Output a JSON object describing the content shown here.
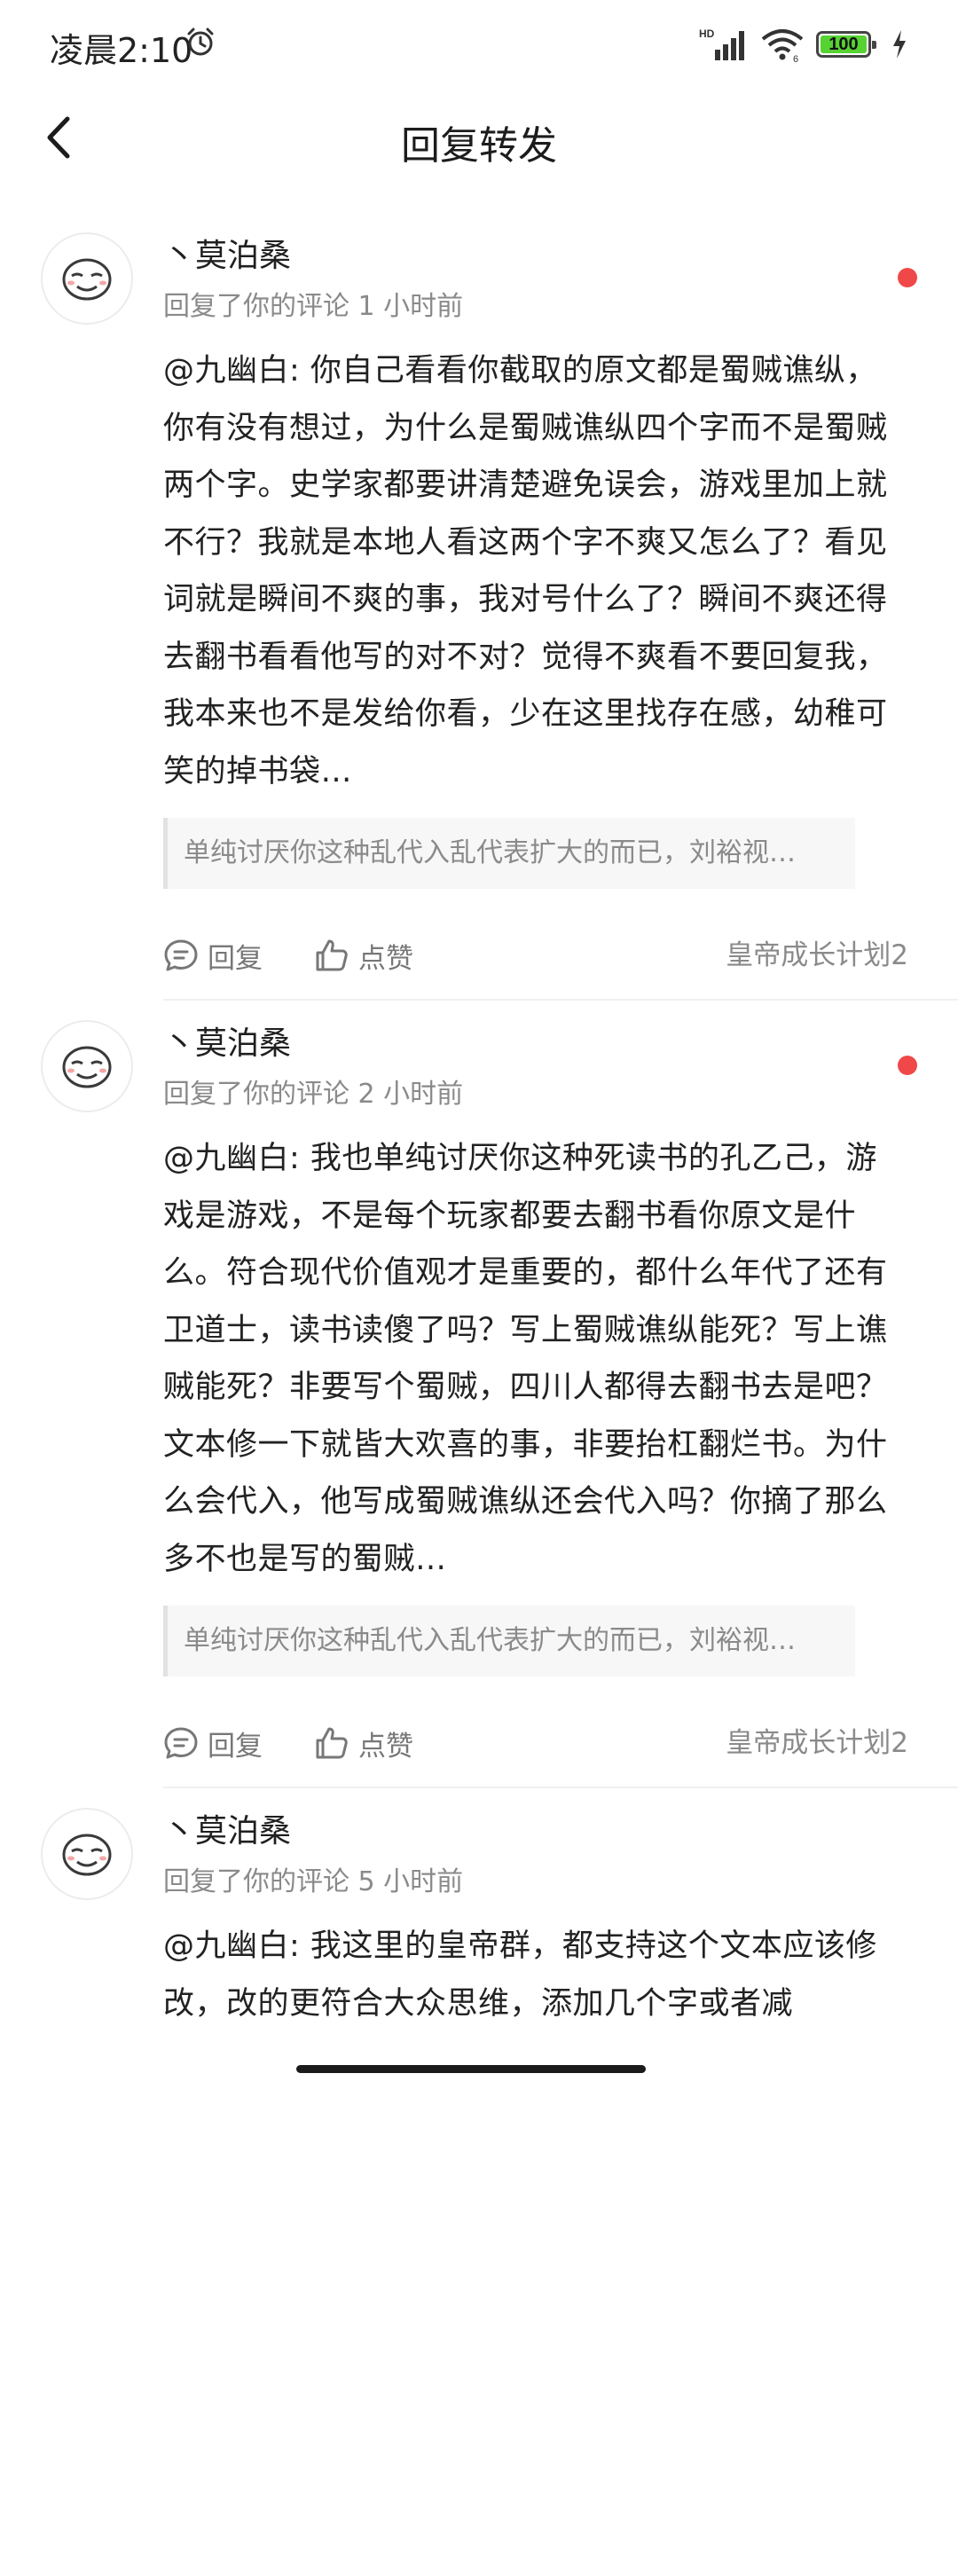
{
  "status_bar": {
    "time": "凌晨2:10",
    "network_label": "HD",
    "battery_level": "100",
    "battery_fraction": 1.0
  },
  "header": {
    "title": "回复转发"
  },
  "colors": {
    "unread_dot": "#f04848",
    "battery_fill": "#57d233"
  },
  "replies": [
    {
      "user": "丶莫泊桑",
      "meta": "回复了你的评论 1 小时前",
      "text": "@九幽白: 你自己看看你截取的原文都是蜀贼谯纵，你有没有想过，为什么是蜀贼谯纵四个字而不是蜀贼两个字。史学家都要讲清楚避免误会，游戏里加上就不行？我就是本地人看这两个字不爽又怎么了？看见词就是瞬间不爽的事，我对号什么了？瞬间不爽还得去翻书看看他写的对不对？觉得不爽看不要回复我，我本来也不是发给你看，少在这里找存在感，幼稚可笑的掉书袋…",
      "quote": "单纯讨厌你这种乱代入乱代表扩大的而已，刘裕视…",
      "reply_label": "回复",
      "like_label": "点赞",
      "source": "皇帝成长计划2"
    },
    {
      "user": "丶莫泊桑",
      "meta": "回复了你的评论 2 小时前",
      "text": "@九幽白: 我也单纯讨厌你这种死读书的孔乙己，游戏是游戏，不是每个玩家都要去翻书看你原文是什么。符合现代价值观才是重要的，都什么年代了还有卫道士，读书读傻了吗？写上蜀贼谯纵能死？写上谯贼能死？非要写个蜀贼，四川人都得去翻书去是吧？文本修一下就皆大欢喜的事，非要抬杠翻烂书。为什么会代入，他写成蜀贼谯纵还会代入吗？你摘了那么多不也是写的蜀贼…",
      "quote": "单纯讨厌你这种乱代入乱代表扩大的而已，刘裕视…",
      "reply_label": "回复",
      "like_label": "点赞",
      "source": "皇帝成长计划2"
    },
    {
      "user": "丶莫泊桑",
      "meta": "回复了你的评论 5 小时前",
      "text": "@九幽白: 我这里的皇帝群，都支持这个文本应该修改，改的更符合大众思维，添加几个字或者减",
      "quote": "",
      "reply_label": "",
      "like_label": "",
      "source": ""
    }
  ]
}
